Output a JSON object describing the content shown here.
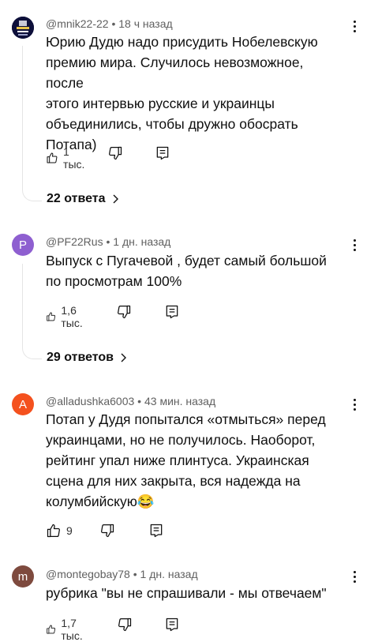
{
  "comments": [
    {
      "author": "@mnik22-22",
      "time": "18 ч назад",
      "text": "Юрию Дудю надо присудить Нобелевскую\nпремию мира. Случилось невозможное, после\nэтого интервью русские и украинцы\nобъединились, чтобы дружно обосрать\nПотапа)",
      "likes": "1 тыс.",
      "replies": "22 ответа",
      "avatar_letter": "",
      "avatar_color": "#0d0f3a"
    },
    {
      "author": "@PF22Rus",
      "time": "1 дн. назад",
      "text": "Выпуск с Пугачевой , будет самый  большой\nпо просмотрам 100%",
      "likes": "1,6 тыс.",
      "replies": "29 ответов",
      "avatar_letter": "P",
      "avatar_color": "#8e5fd0"
    },
    {
      "author": "@alladushka6003",
      "time": "43 мин. назад",
      "text": "Потап у Дудя попытался «отмыться» перед\nукраинцами, но не получилось. Наоборот,\nрейтинг упал ниже плинтуса. Украинская\nсцена для них закрыта, вся надежда на\nколумбийскую😂",
      "likes": "9",
      "replies": "",
      "avatar_letter": "A",
      "avatar_color": "#f4511e"
    },
    {
      "author": "@montegobay78",
      "time": "1 дн. назад",
      "text": "рубрика \"вы не спрашивали - мы отвечаем\"",
      "likes": "1,7 тыс.",
      "replies": "",
      "avatar_letter": "m",
      "avatar_color": "#7e4a3e"
    }
  ],
  "separator": " • ",
  "icons": {
    "like": "thumb-up-icon",
    "dislike": "thumb-down-icon",
    "reply": "reply-comment-icon",
    "more": "more-vertical-icon",
    "chevron": "chevron-right-icon"
  }
}
